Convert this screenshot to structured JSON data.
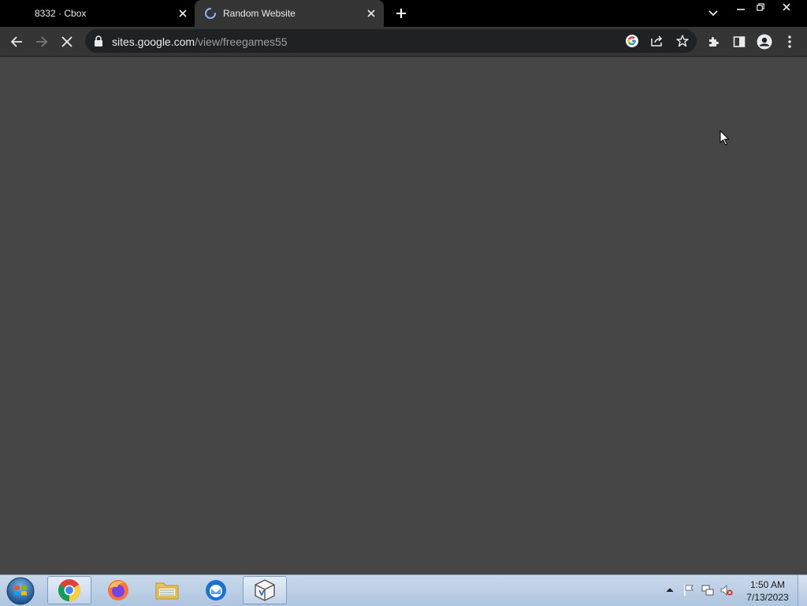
{
  "window": {
    "tabs": [
      {
        "label": "8332 · Cbox",
        "active": false
      },
      {
        "label": "Random Website",
        "active": true,
        "loading": true
      }
    ]
  },
  "toolbar": {
    "url_host": "sites.google.com",
    "url_path": "/view/freegames55"
  },
  "icons": {
    "back": "back-arrow-icon",
    "forward": "forward-arrow-icon",
    "stop": "stop-loading-icon",
    "lock": "lock-icon",
    "google": "google-lens-icon",
    "share": "share-icon",
    "bookmark": "star-icon",
    "extensions": "puzzle-icon",
    "side_panel": "side-panel-icon",
    "profile": "profile-icon",
    "menu": "kebab-menu-icon"
  },
  "taskbar": {
    "apps": [
      "chrome",
      "firefox",
      "file-explorer",
      "thunderbird",
      "virtualbox"
    ],
    "clock_time": "1:50 AM",
    "clock_date": "7/13/2023"
  },
  "colors": {
    "tab_strip": "#000000",
    "toolbar": "#353535",
    "omnibox": "#202124",
    "page_bg": "#464646",
    "spinner": "#8ab4f8"
  }
}
